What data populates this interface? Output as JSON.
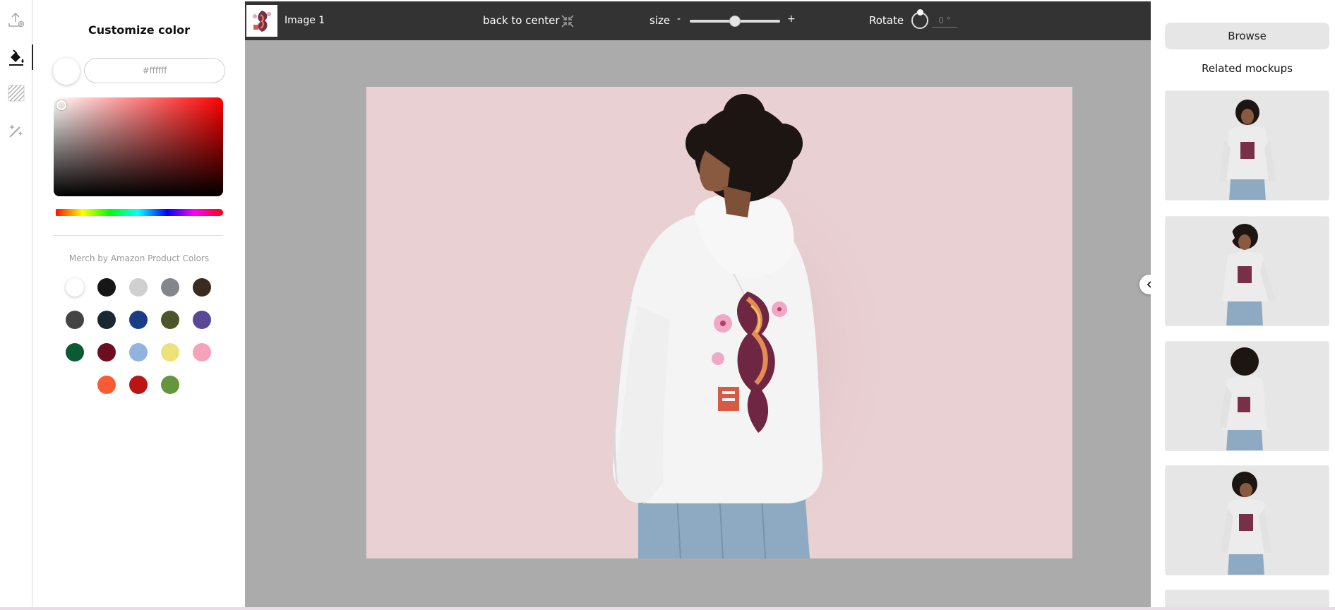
{
  "sidebar": {
    "tools": [
      {
        "name": "upload-image"
      },
      {
        "name": "fill-color"
      },
      {
        "name": "pattern"
      },
      {
        "name": "magic-edit"
      }
    ]
  },
  "color_panel": {
    "title": "Customize color",
    "current_color": "#ffffff",
    "hex_placeholder": "#ffffff",
    "palette_title": "Merch by Amazon Product Colors",
    "swatches": [
      "#ffffff",
      "#161616",
      "#d0d0d0",
      "#85858d",
      "#3a2b20",
      "#444444",
      "#1a2630",
      "#1a3d88",
      "#4c5628",
      "#5a4796",
      "#0a5a34",
      "#6d0d22",
      "#90b4de",
      "#ede27a",
      "#f6a2bb",
      "#fb5a32",
      "#ba1414",
      "#64963e"
    ]
  },
  "toolbar": {
    "image_name": "Image 1",
    "center_label": "back to center",
    "size_label": "size",
    "minus": "-",
    "plus": "+",
    "size_value": 0.5,
    "rotate_label": "Rotate",
    "rotate_placeholder": "0 °"
  },
  "right_panel": {
    "browse_label": "Browse",
    "related_title": "Related mockups",
    "mockups": [
      "front-pose",
      "hand-in-hair",
      "back-view",
      "laughing-pose"
    ]
  }
}
